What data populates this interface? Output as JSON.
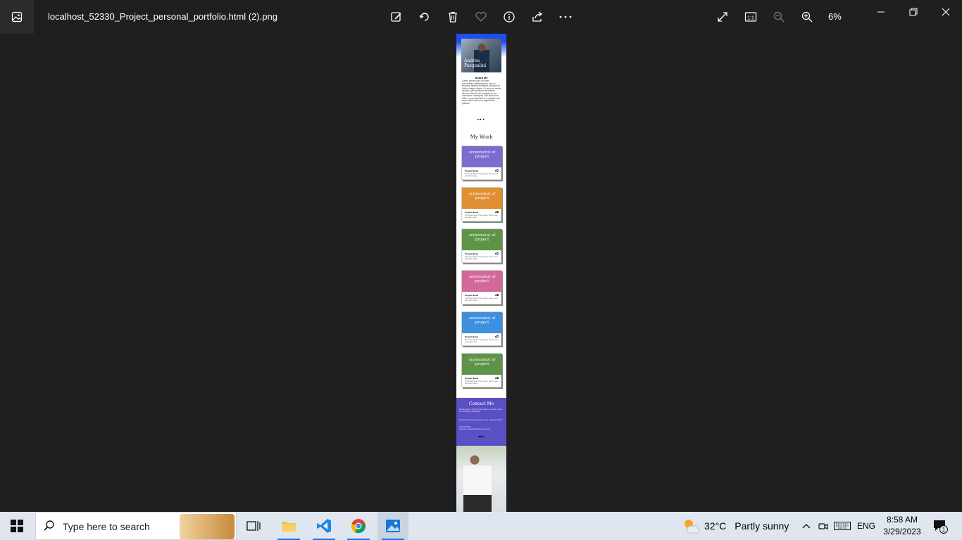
{
  "window": {
    "title": "localhost_52330_Project_personal_portfolio.html (2).png",
    "zoom": "6%"
  },
  "page": {
    "hero_name": "Andrea Pasqualini",
    "about_title": "About Me",
    "about_text": "Lorem ipsum dolor sit amet, consectetur adipiscing elit, sed do eiusmod tempor incididunt ut labore et dolore magna aliqua. Ut enim ad minim veniam, quis nostrud exercitation ullamco laboris nisi ut aliquip ex ea commodo consequat. Duis aute irure dolor in reprehenderit in voluptate velit esse cillum dolore eu fugiat nulla pariatur.",
    "work_title": "My Work",
    "projects": [
      {
        "shot": "screenshot of project",
        "name": "Project Name",
        "desc": "Short description of the project, tools it used and what it does.",
        "color": "#7b6ccf"
      },
      {
        "shot": "screenshot of project",
        "name": "Project Name",
        "desc": "Short description of the project, tools it used and what it does.",
        "color": "#e08f33"
      },
      {
        "shot": "screenshot of project",
        "name": "Project Name",
        "desc": "Short description of the project, tools it used and what it does.",
        "color": "#5e9448"
      },
      {
        "shot": "screenshot of project",
        "name": "Project Name",
        "desc": "Short description of the project, tools it used and what it does.",
        "color": "#d3689b"
      },
      {
        "shot": "screenshot of project",
        "name": "Project Name",
        "desc": "Short description of the project, tools it used and what it does.",
        "color": "#3f8fe0"
      },
      {
        "shot": "screenshot of project",
        "name": "Project Name",
        "desc": "Short description of the project, tools it used and what it does.",
        "color": "#5e9448"
      }
    ],
    "contact_title": "Contact Me",
    "contact_text": "Please get in touch if you think our work could be mutually beneficial!",
    "contact_address": "1234 Random Road, Random town, California 12345",
    "contact_phone": "555-555-5555",
    "contact_email": "andrea_pasqualini@randomgmail.com"
  },
  "taskbar": {
    "search_placeholder": "Type here to search",
    "weather_temp": "32°C",
    "weather_text": "Partly sunny",
    "lang": "ENG",
    "time": "8:58 AM",
    "date": "3/29/2023",
    "notification_count": "1"
  }
}
